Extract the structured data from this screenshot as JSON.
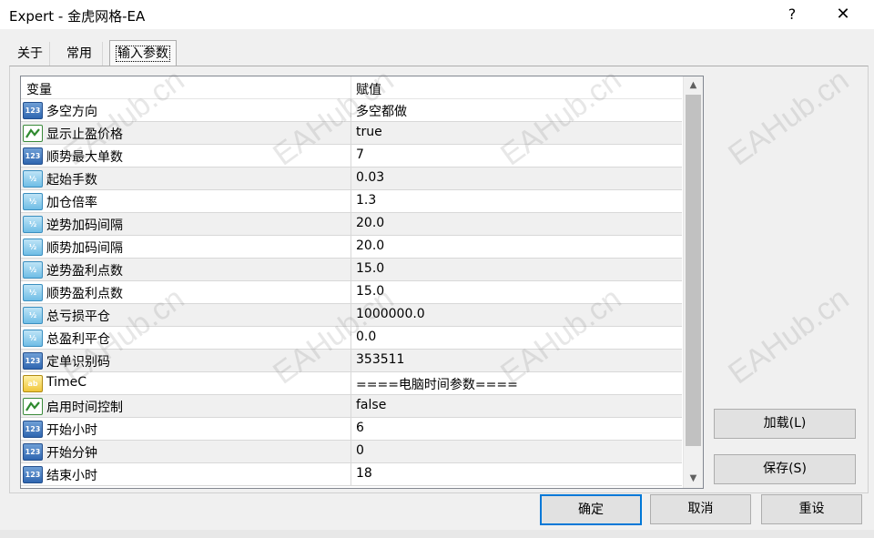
{
  "window": {
    "title": "Expert - 金虎网格-EA",
    "help_glyph": "?",
    "close_glyph": "✕"
  },
  "tabs": [
    {
      "label": "关于"
    },
    {
      "label": "常用"
    },
    {
      "label": "输入参数"
    }
  ],
  "grid": {
    "columns": {
      "variable": "变量",
      "value": "赋值"
    },
    "rows": [
      {
        "icon": "integer-icon",
        "icon_text": "123",
        "name": "多空方向",
        "value": "多空都做"
      },
      {
        "icon": "boolean-icon",
        "icon_text": "",
        "name": "显示止盈价格",
        "value": "true"
      },
      {
        "icon": "integer-icon",
        "icon_text": "123",
        "name": "顺势最大单数",
        "value": "7"
      },
      {
        "icon": "double-icon",
        "icon_text": "½",
        "name": "起始手数",
        "value": "0.03"
      },
      {
        "icon": "double-icon",
        "icon_text": "½",
        "name": "加仓倍率",
        "value": "1.3"
      },
      {
        "icon": "double-icon",
        "icon_text": "½",
        "name": "逆势加码间隔",
        "value": "20.0"
      },
      {
        "icon": "double-icon",
        "icon_text": "½",
        "name": "顺势加码间隔",
        "value": "20.0"
      },
      {
        "icon": "double-icon",
        "icon_text": "½",
        "name": "逆势盈利点数",
        "value": "15.0"
      },
      {
        "icon": "double-icon",
        "icon_text": "½",
        "name": "顺势盈利点数",
        "value": "15.0"
      },
      {
        "icon": "double-icon",
        "icon_text": "½",
        "name": "总亏损平仓",
        "value": "1000000.0"
      },
      {
        "icon": "double-icon",
        "icon_text": "½",
        "name": "总盈利平仓",
        "value": "0.0"
      },
      {
        "icon": "integer-icon",
        "icon_text": "123",
        "name": "定单识别码",
        "value": "353511"
      },
      {
        "icon": "string-icon",
        "icon_text": "ab",
        "name": "TimeC",
        "value": "====电脑时间参数===="
      },
      {
        "icon": "boolean-icon",
        "icon_text": "",
        "name": "启用时间控制",
        "value": "false"
      },
      {
        "icon": "integer-icon",
        "icon_text": "123",
        "name": "开始小时",
        "value": "6"
      },
      {
        "icon": "integer-icon",
        "icon_text": "123",
        "name": "开始分钟",
        "value": "0"
      },
      {
        "icon": "integer-icon",
        "icon_text": "123",
        "name": "结束小时",
        "value": "18"
      }
    ]
  },
  "buttons": {
    "load": "加载(L)",
    "save": "保存(S)",
    "ok": "确定",
    "cancel": "取消",
    "reset": "重设"
  },
  "watermark_text": "EAHub.cn",
  "colors": {
    "focus_border": "#0078d7",
    "boolean_icon": "#3a8a3a",
    "integer_icon": "#2f66b0",
    "double_icon": "#6fbde6",
    "string_icon": "#f0c63a"
  }
}
